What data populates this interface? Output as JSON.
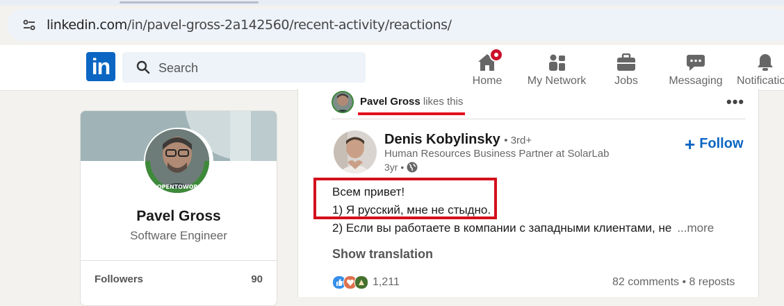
{
  "browser": {
    "url_domain": "linkedin.com",
    "url_path": "/in/pavel-gross-2a142560/recent-activity/reactions/"
  },
  "header": {
    "logo_text": "in",
    "search_placeholder": "Search",
    "nav": [
      {
        "label": "Home",
        "icon": "home-icon",
        "notification": true
      },
      {
        "label": "My Network",
        "icon": "people-icon"
      },
      {
        "label": "Jobs",
        "icon": "briefcase-icon"
      },
      {
        "label": "Messaging",
        "icon": "chat-icon"
      },
      {
        "label": "Notifications",
        "icon": "bell-icon"
      }
    ],
    "brand_color": "#0a66c2",
    "badge_color": "#cb112d"
  },
  "profile": {
    "name": "Pavel Gross",
    "headline": "Software Engineer",
    "badge_text": "#OPENTOWORK",
    "followers_label": "Followers",
    "followers_count": "90"
  },
  "activity": {
    "actor": "Pavel Gross",
    "action": "likes this",
    "highlight_color": "#e3101d"
  },
  "post": {
    "author_name": "Denis Kobylinsky",
    "degree": "• 3rd+",
    "headline": "Human Resources Business Partner at SolarLab",
    "time": "3yr •",
    "visibility_icon": "globe-icon",
    "follow_label": "Follow",
    "lines": [
      "Всем привет!",
      "1) Я русский, мне не стыдно.",
      "2) Если вы работаете в компании с западными клиентами, не"
    ],
    "see_more": "...more",
    "show_translation": "Show translation",
    "reactions_count": "1,211",
    "reaction_icons": [
      "like-icon",
      "love-icon",
      "celebrate-icon"
    ],
    "comments_reposts": "82 comments • 8 reposts"
  }
}
